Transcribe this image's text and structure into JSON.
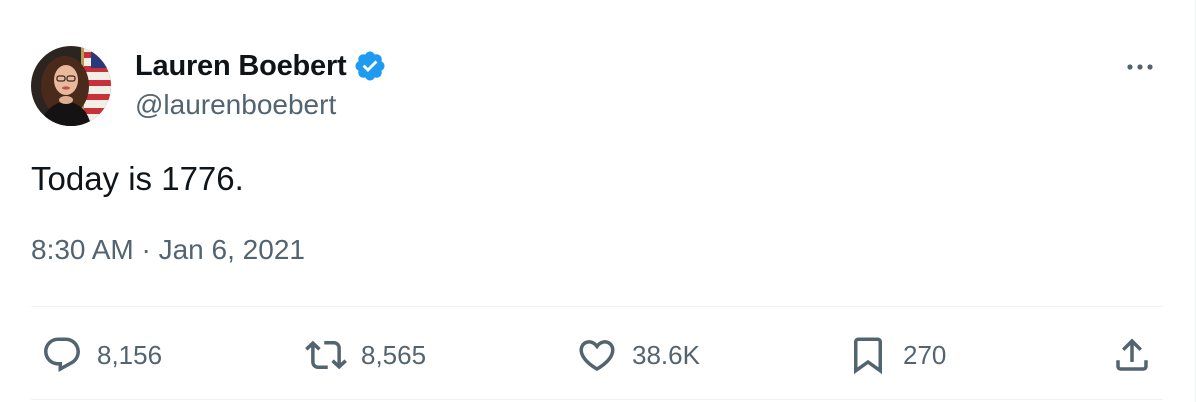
{
  "author": {
    "display_name": "Lauren Boebert",
    "handle": "@laurenboebert",
    "verified": true
  },
  "tweet": {
    "text": "Today is 1776.",
    "timestamp": "8:30 AM · Jan 6, 2021"
  },
  "actions": {
    "replies": "8,156",
    "retweets": "8,565",
    "likes": "38.6K",
    "bookmarks": "270"
  },
  "icons": {
    "more": "more-icon",
    "reply": "reply-icon",
    "retweet": "retweet-icon",
    "like": "heart-icon",
    "bookmark": "bookmark-icon",
    "share": "share-icon",
    "verified": "verified-badge-icon"
  },
  "colors": {
    "text_primary": "#0f1419",
    "text_secondary": "#536471",
    "verified_blue": "#1d9bf0",
    "divider": "#eff3f4"
  }
}
